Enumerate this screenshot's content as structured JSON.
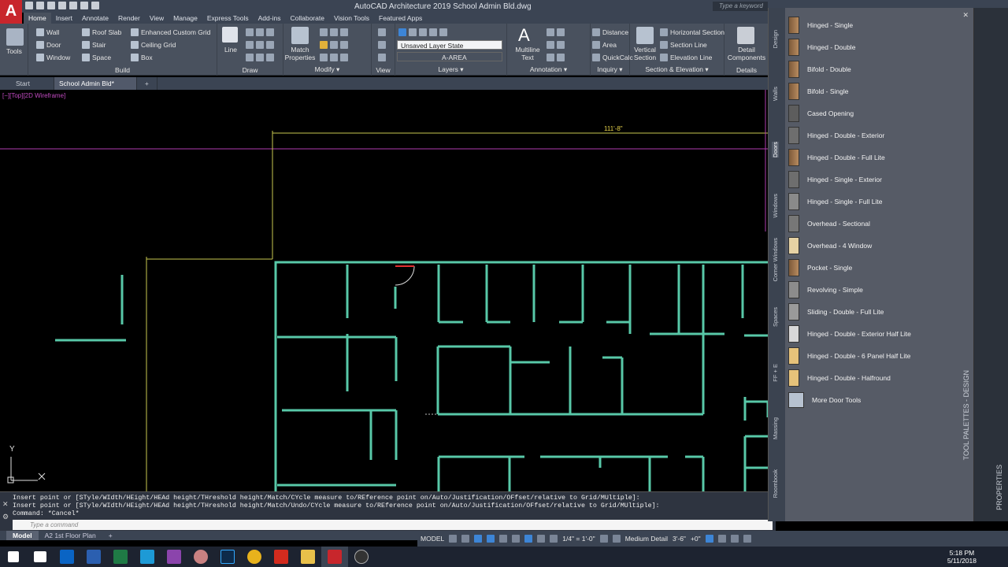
{
  "app": {
    "logo": "A",
    "title": "AutoCAD Architecture 2019    School Admin Bld.dwg",
    "search_placeholder": "Type a keyword or"
  },
  "ribbon_tabs": [
    "Home",
    "Insert",
    "Annotate",
    "Render",
    "View",
    "Manage",
    "Express Tools",
    "Add-ins",
    "Collaborate",
    "Vision Tools",
    "Featured Apps"
  ],
  "ribbon": {
    "tools": "Tools",
    "build": {
      "label": "Build",
      "wall": "Wall",
      "door": "Door",
      "window": "Window",
      "roof_slab": "Roof Slab",
      "stair": "Stair",
      "space": "Space",
      "grid": "Enhanced Custom Grid",
      "ceiling_grid": "Ceiling Grid",
      "box": "Box"
    },
    "draw": {
      "label": "Draw",
      "line": "Line"
    },
    "modify": {
      "label": "Modify ▾",
      "match": "Match\nProperties"
    },
    "view": {
      "label": "View"
    },
    "layers": {
      "label": "Layers ▾",
      "state": "Unsaved Layer State",
      "layer": "A-AREA"
    },
    "annotation": {
      "label": "Annotation ▾",
      "mtext": "Multiline\nText"
    },
    "inquiry": {
      "label": "Inquiry ▾",
      "distance": "Distance",
      "area": "Area",
      "quickcalc": "QuickCalc"
    },
    "section": {
      "label": "Section & Elevation ▾",
      "vertical": "Vertical\nSection",
      "horizontal": "Horizontal Section",
      "section_line": "Section Line",
      "elevation_line": "Elevation Line"
    },
    "details": {
      "label": "Details",
      "detail": "Detail\nComponents"
    }
  },
  "doc_tabs": [
    "Start",
    "School Admin Bld*",
    "+"
  ],
  "viewport_label": "[−][Top][2D Wireframe]",
  "dimension_text": "111'-8\"",
  "ucs": {
    "y": "Y"
  },
  "command": {
    "lines": [
      "Insert point or [STyle/WIdth/HEight/HEAd height/THreshold height/Match/CYcle measure to/REference point on/Auto/Justification/OFfset/relative to Grid/MUltiple]:",
      "Insert point or [STyle/WIdth/HEight/HEAd height/THreshold height/Match/Undo/CYcle measure to/REference point on/Auto/Justification/OFfset/relative to Grid/MUltiple]:",
      "Command: *Cancel*"
    ],
    "placeholder": "Type a command"
  },
  "layout_tabs": [
    "Model",
    "A2 1st Floor Plan",
    "+"
  ],
  "status": {
    "model": "MODEL",
    "scale": "1/4\" = 1'-0\"",
    "detail": "Medium Detail",
    "elevation": "3'-6\"",
    "offset": "+0\""
  },
  "palette": {
    "title": "TOOL PALETTES - DESIGN",
    "tabs": [
      "Design",
      "Walls",
      "Doors",
      "Windows",
      "Corner Windows",
      "Spaces",
      "FF + E",
      "Massing",
      "Roombook"
    ],
    "active_tab": "Doors",
    "items": [
      "Hinged - Single",
      "Hinged - Double",
      "Bifold - Double",
      "Bifold - Single",
      "Cased Opening",
      "Hinged - Double - Exterior",
      "Hinged - Double - Full Lite",
      "Hinged - Single - Exterior",
      "Hinged - Single - Full Lite",
      "Overhead - Sectional",
      "Overhead - 4 Window",
      "Pocket - Single",
      "Revolving - Simple",
      "Sliding - Double - Full Lite",
      "Hinged - Double - Exterior Half Lite",
      "Hinged - Double - 6 Panel Half Lite",
      "Hinged - Double - Halfround",
      "More Door Tools"
    ]
  },
  "properties_title": "PROPERTIES",
  "clock": {
    "time": "5:18 PM",
    "date": "5/11/2018"
  },
  "colors": {
    "wall": "#58c8a8",
    "grid": "#c8c850",
    "magenta": "#b03cb0",
    "accent": "#c8262c"
  }
}
